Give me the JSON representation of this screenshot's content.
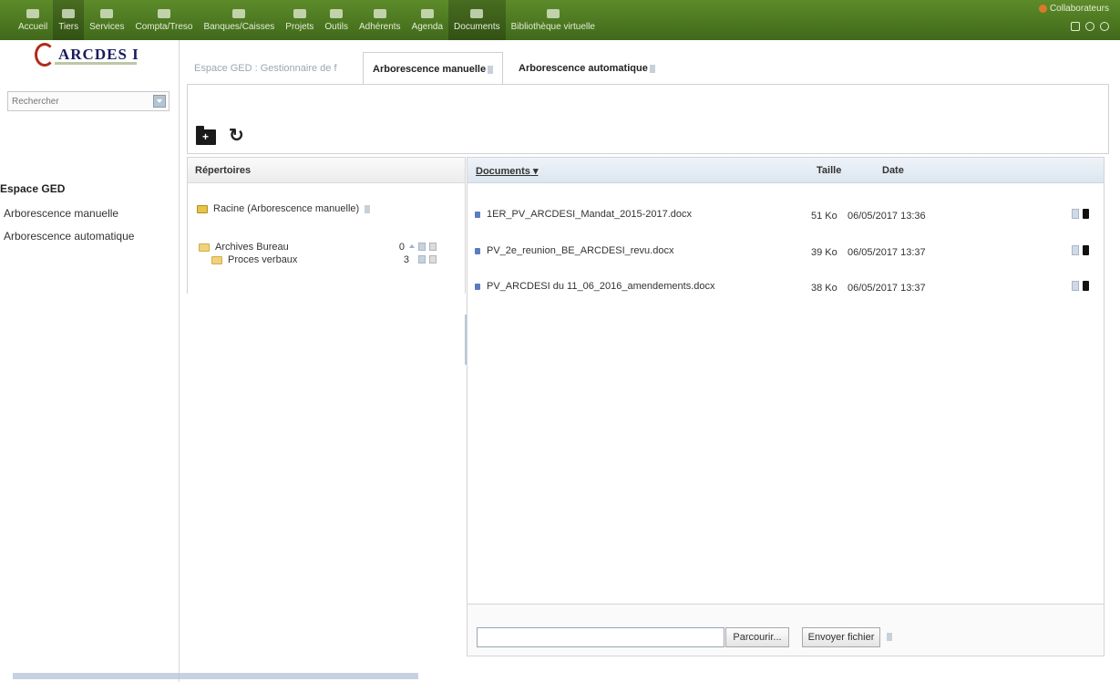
{
  "nav": {
    "items": [
      {
        "label": "Accueil"
      },
      {
        "label": "Tiers",
        "active": true
      },
      {
        "label": "Services"
      },
      {
        "label": "Compta/Treso"
      },
      {
        "label": "Banques/Caisses"
      },
      {
        "label": "Projets"
      },
      {
        "label": "Outils"
      },
      {
        "label": "Adhérents"
      },
      {
        "label": "Agenda"
      },
      {
        "label": "Documents",
        "active": true
      },
      {
        "label": "Bibliothèque virtuelle"
      }
    ],
    "user": "Collaborateurs",
    "colors": {
      "bar": "#4f7a22",
      "active": "#36561a"
    }
  },
  "logo": {
    "text": "ARCDES I"
  },
  "sidebar": {
    "search_placeholder": "Rechercher",
    "title": "Espace GED",
    "links": [
      "Arborescence manuelle",
      "Arborescence automatique"
    ]
  },
  "tabs": {
    "breadcrumb": "Espace GED : Gestionnaire de f",
    "manual": "Arborescence manuelle",
    "auto": "Arborescence automatique"
  },
  "directories": {
    "header": "Répertoires",
    "root": "Racine (Arborescence manuelle)",
    "folders": [
      {
        "name": "Archives Bureau",
        "count": "0"
      },
      {
        "name": "Proces verbaux",
        "count": "3"
      }
    ]
  },
  "documents": {
    "columns": {
      "name": "Documents ▾",
      "size": "Taille",
      "date": "Date"
    },
    "rows": [
      {
        "name": "1ER_PV_ARCDESI_Mandat_2015-2017.docx",
        "size": "51 Ko",
        "date": "06/05/2017 13:36"
      },
      {
        "name": "PV_2e_reunion_BE_ARCDESI_revu.docx",
        "size": "39 Ko",
        "date": "06/05/2017 13:37"
      },
      {
        "name": "PV_ARCDESI du 11_06_2016_amendements.docx",
        "size": "38 Ko",
        "date": "06/05/2017 13:37"
      }
    ]
  },
  "upload": {
    "browse_label": "Parcourir...",
    "send_label": "Envoyer fichier"
  }
}
